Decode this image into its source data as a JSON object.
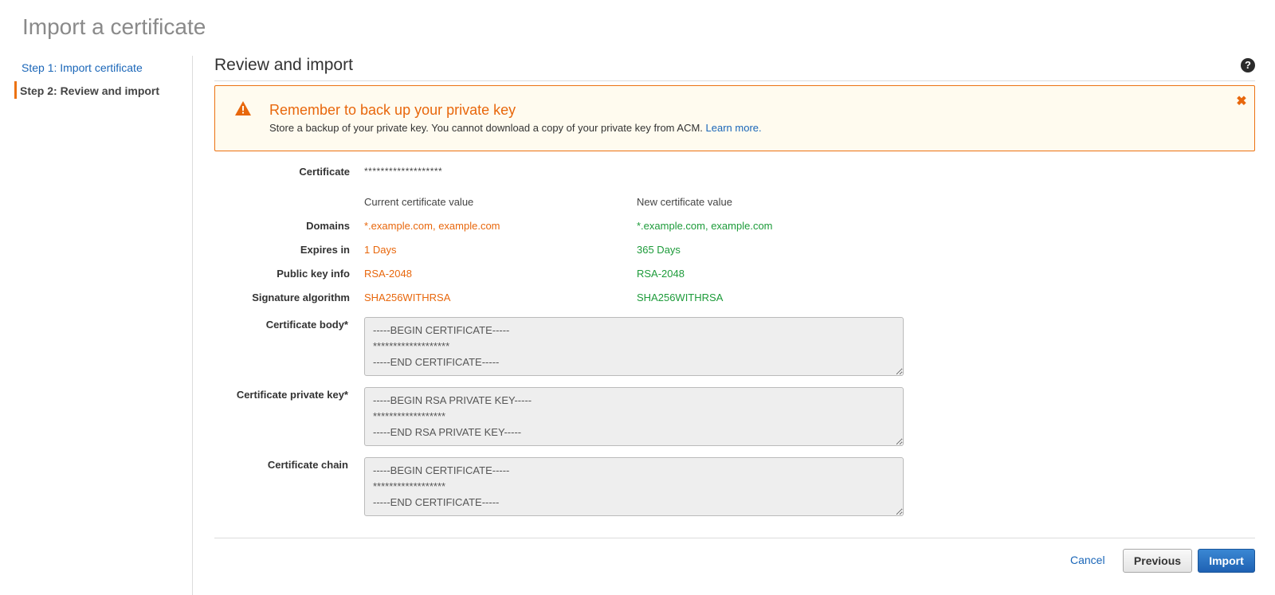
{
  "page": {
    "title": "Import a certificate"
  },
  "sidebar": {
    "steps": [
      {
        "label": "Step 1: Import certificate",
        "active": false
      },
      {
        "label": "Step 2: Review and import",
        "active": true
      }
    ]
  },
  "section": {
    "title": "Review and import",
    "help_icon": "question-circle-icon"
  },
  "alert": {
    "icon": "warning-triangle-icon",
    "title": "Remember to back up your private key",
    "text": "Store a backup of your private key. You cannot download a copy of your private key from ACM.",
    "link": "Learn more.",
    "close_icon": "close-icon"
  },
  "certificate": {
    "label": "Certificate",
    "masked": "*******************",
    "current_header": "Current certificate value",
    "new_header": "New certificate value",
    "rows": [
      {
        "label": "Domains",
        "current": "*.example.com, example.com",
        "new": "*.example.com, example.com"
      },
      {
        "label": "Expires in",
        "current": "1 Days",
        "new": "365 Days"
      },
      {
        "label": "Public key info",
        "current": "RSA-2048",
        "new": "RSA-2048"
      },
      {
        "label": "Signature algorithm",
        "current": "SHA256WITHRSA",
        "new": "SHA256WITHRSA"
      }
    ]
  },
  "fields": {
    "body": {
      "label": "Certificate body*",
      "value": "-----BEGIN CERTIFICATE-----\n*******************\n-----END CERTIFICATE-----"
    },
    "private_key": {
      "label": "Certificate private key*",
      "value": "-----BEGIN RSA PRIVATE KEY-----\n******************\n-----END RSA PRIVATE KEY-----"
    },
    "chain": {
      "label": "Certificate chain",
      "value": "-----BEGIN CERTIFICATE-----\n******************\n-----END CERTIFICATE-----"
    }
  },
  "actions": {
    "cancel": "Cancel",
    "previous": "Previous",
    "import": "Import"
  },
  "colors": {
    "accent": "#ec7211",
    "current_value": "#e8670c",
    "new_value": "#1d9b3a",
    "link": "#1a66b8",
    "primary_button": "#1f62b3"
  }
}
